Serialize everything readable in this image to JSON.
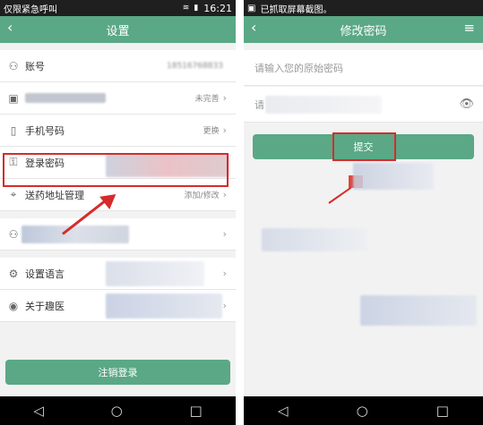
{
  "left": {
    "status": {
      "left_text": "仅限紧急呼叫",
      "time": "16:21"
    },
    "title": "设置",
    "rows": [
      {
        "label": "账号",
        "value": "18516768833"
      },
      {
        "label": "",
        "value": "未完善"
      },
      {
        "label": "手机号码",
        "value": "更换"
      },
      {
        "label": "登录密码",
        "value": ""
      },
      {
        "label": "送药地址管理",
        "value": "添加/修改"
      },
      {
        "label": "",
        "value": ""
      },
      {
        "label": "设置语言",
        "value": ""
      },
      {
        "label": "关于趣医",
        "value": ""
      }
    ],
    "logout_label": "注销登录"
  },
  "right": {
    "status": {
      "left_text": "已抓取屏幕截图。"
    },
    "title": "修改密码",
    "old_placeholder": "请输入您的原始密码",
    "new_placeholder": "请",
    "submit_label": "提交"
  },
  "nav": {
    "back": "◁",
    "home": "○",
    "recent": "□"
  },
  "colors": {
    "accent": "#5aa886",
    "annotation": "#d62b2b"
  }
}
